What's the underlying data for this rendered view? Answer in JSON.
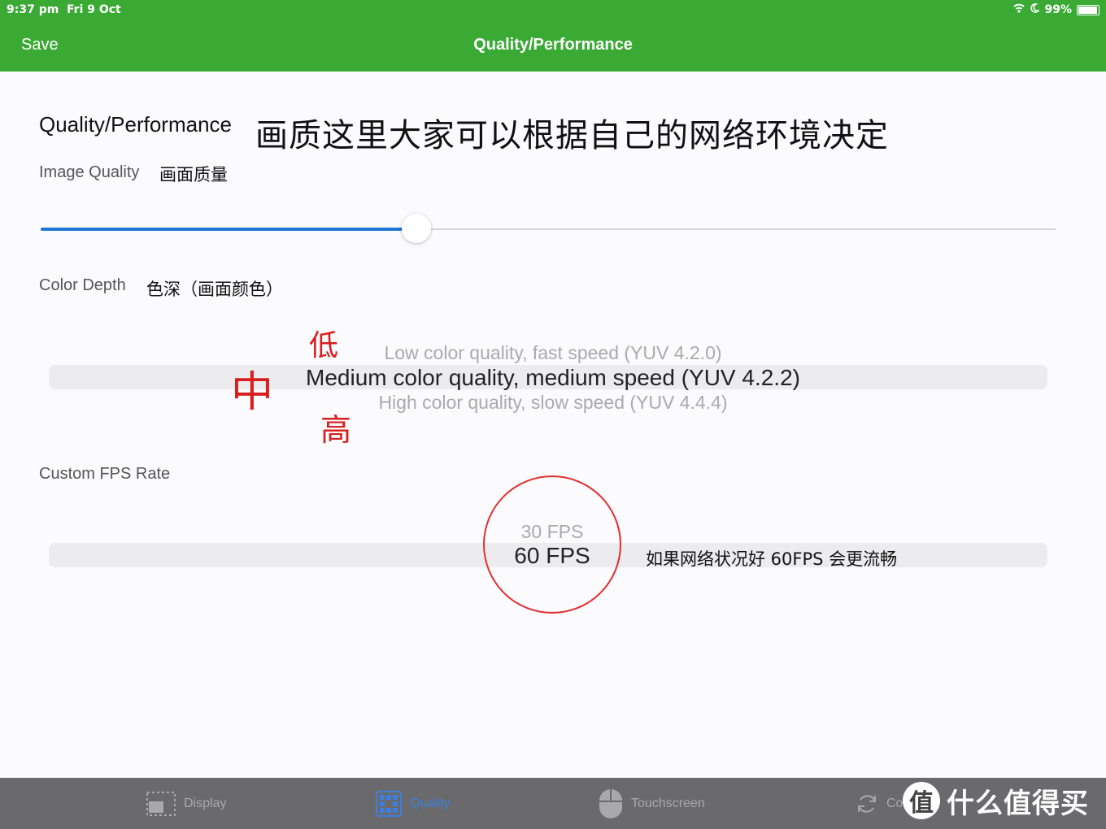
{
  "status_bar": {
    "time": "9:37 pm",
    "date": "Fri 9 Oct",
    "battery": "99%",
    "icons": [
      "wifi-icon",
      "moon-icon",
      "battery-icon"
    ]
  },
  "nav": {
    "save_label": "Save",
    "title": "Quality/Performance"
  },
  "section": {
    "title": "Quality/Performance",
    "note": "画质这里大家可以根据自己的网络环境决定"
  },
  "image_quality": {
    "label": "Image Quality",
    "note": "画面质量",
    "slider_value_pct": 37
  },
  "color_depth": {
    "label": "Color Depth",
    "note": "色深（画面颜色）",
    "options": [
      "Low color quality, fast speed (YUV 4.2.0)",
      "Medium color quality, medium speed (YUV 4.2.2)",
      "High color quality, slow speed (YUV 4.4.4)"
    ],
    "selected_index": 1,
    "annotations": {
      "low": "低",
      "mid": "中",
      "high": "高"
    }
  },
  "fps": {
    "label": "Custom FPS Rate",
    "options": [
      "30 FPS",
      "60 FPS"
    ],
    "selected": "60 FPS",
    "note": "如果网络状况好 60FPS 会更流畅"
  },
  "tabs": [
    {
      "label": "Display",
      "icon": "display-icon",
      "active": false
    },
    {
      "label": "Quality",
      "icon": "quality-icon",
      "active": true
    },
    {
      "label": "Touchscreen",
      "icon": "mouse-icon",
      "active": false
    },
    {
      "label": "Co",
      "icon": "sync-icon",
      "active": false
    }
  ],
  "watermark": {
    "badge": "值",
    "text": "什么值得买"
  },
  "colors": {
    "accent_green": "#3aaa35",
    "slider_blue": "#1f77d4",
    "annotation_red": "#d81e1e",
    "tabbar": "#6a6a6c"
  }
}
